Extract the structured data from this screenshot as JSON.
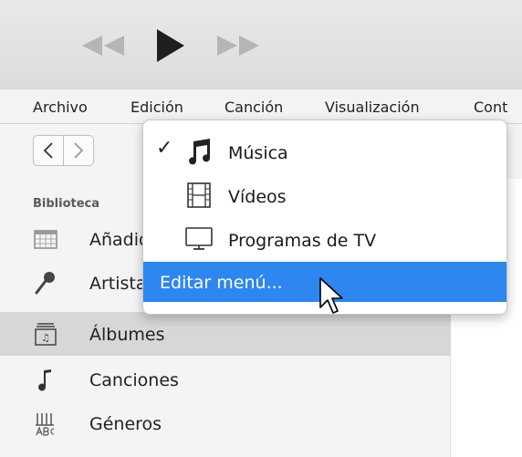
{
  "menubar": {
    "items": [
      "Archivo",
      "Edición",
      "Canción",
      "Visualización",
      "Cont"
    ]
  },
  "sidebar": {
    "header": "Biblioteca",
    "items": [
      {
        "label": "Añadido recientemente",
        "icon": "calendar-grid-icon"
      },
      {
        "label": "Artistas",
        "icon": "microphone-icon"
      },
      {
        "label": "Álbumes",
        "icon": "album-icon",
        "selected": true
      },
      {
        "label": "Canciones",
        "icon": "music-note-icon"
      },
      {
        "label": "Géneros",
        "icon": "genres-icon"
      }
    ]
  },
  "dropdown": {
    "items": [
      {
        "label": "Música",
        "icon": "music-note-icon",
        "checked": true,
        "check_mark": "✓"
      },
      {
        "label": "Vídeos",
        "icon": "film-icon",
        "checked": false
      },
      {
        "label": "Programas de TV",
        "icon": "tv-monitor-icon",
        "checked": false
      }
    ],
    "edit_label": "Editar menú..."
  },
  "colors": {
    "highlight": "#2e86f0",
    "sidebar_selected": "#d7d7d7",
    "toolbar_icon": "#b5b5b5",
    "play_icon": "#1f1f1f"
  }
}
